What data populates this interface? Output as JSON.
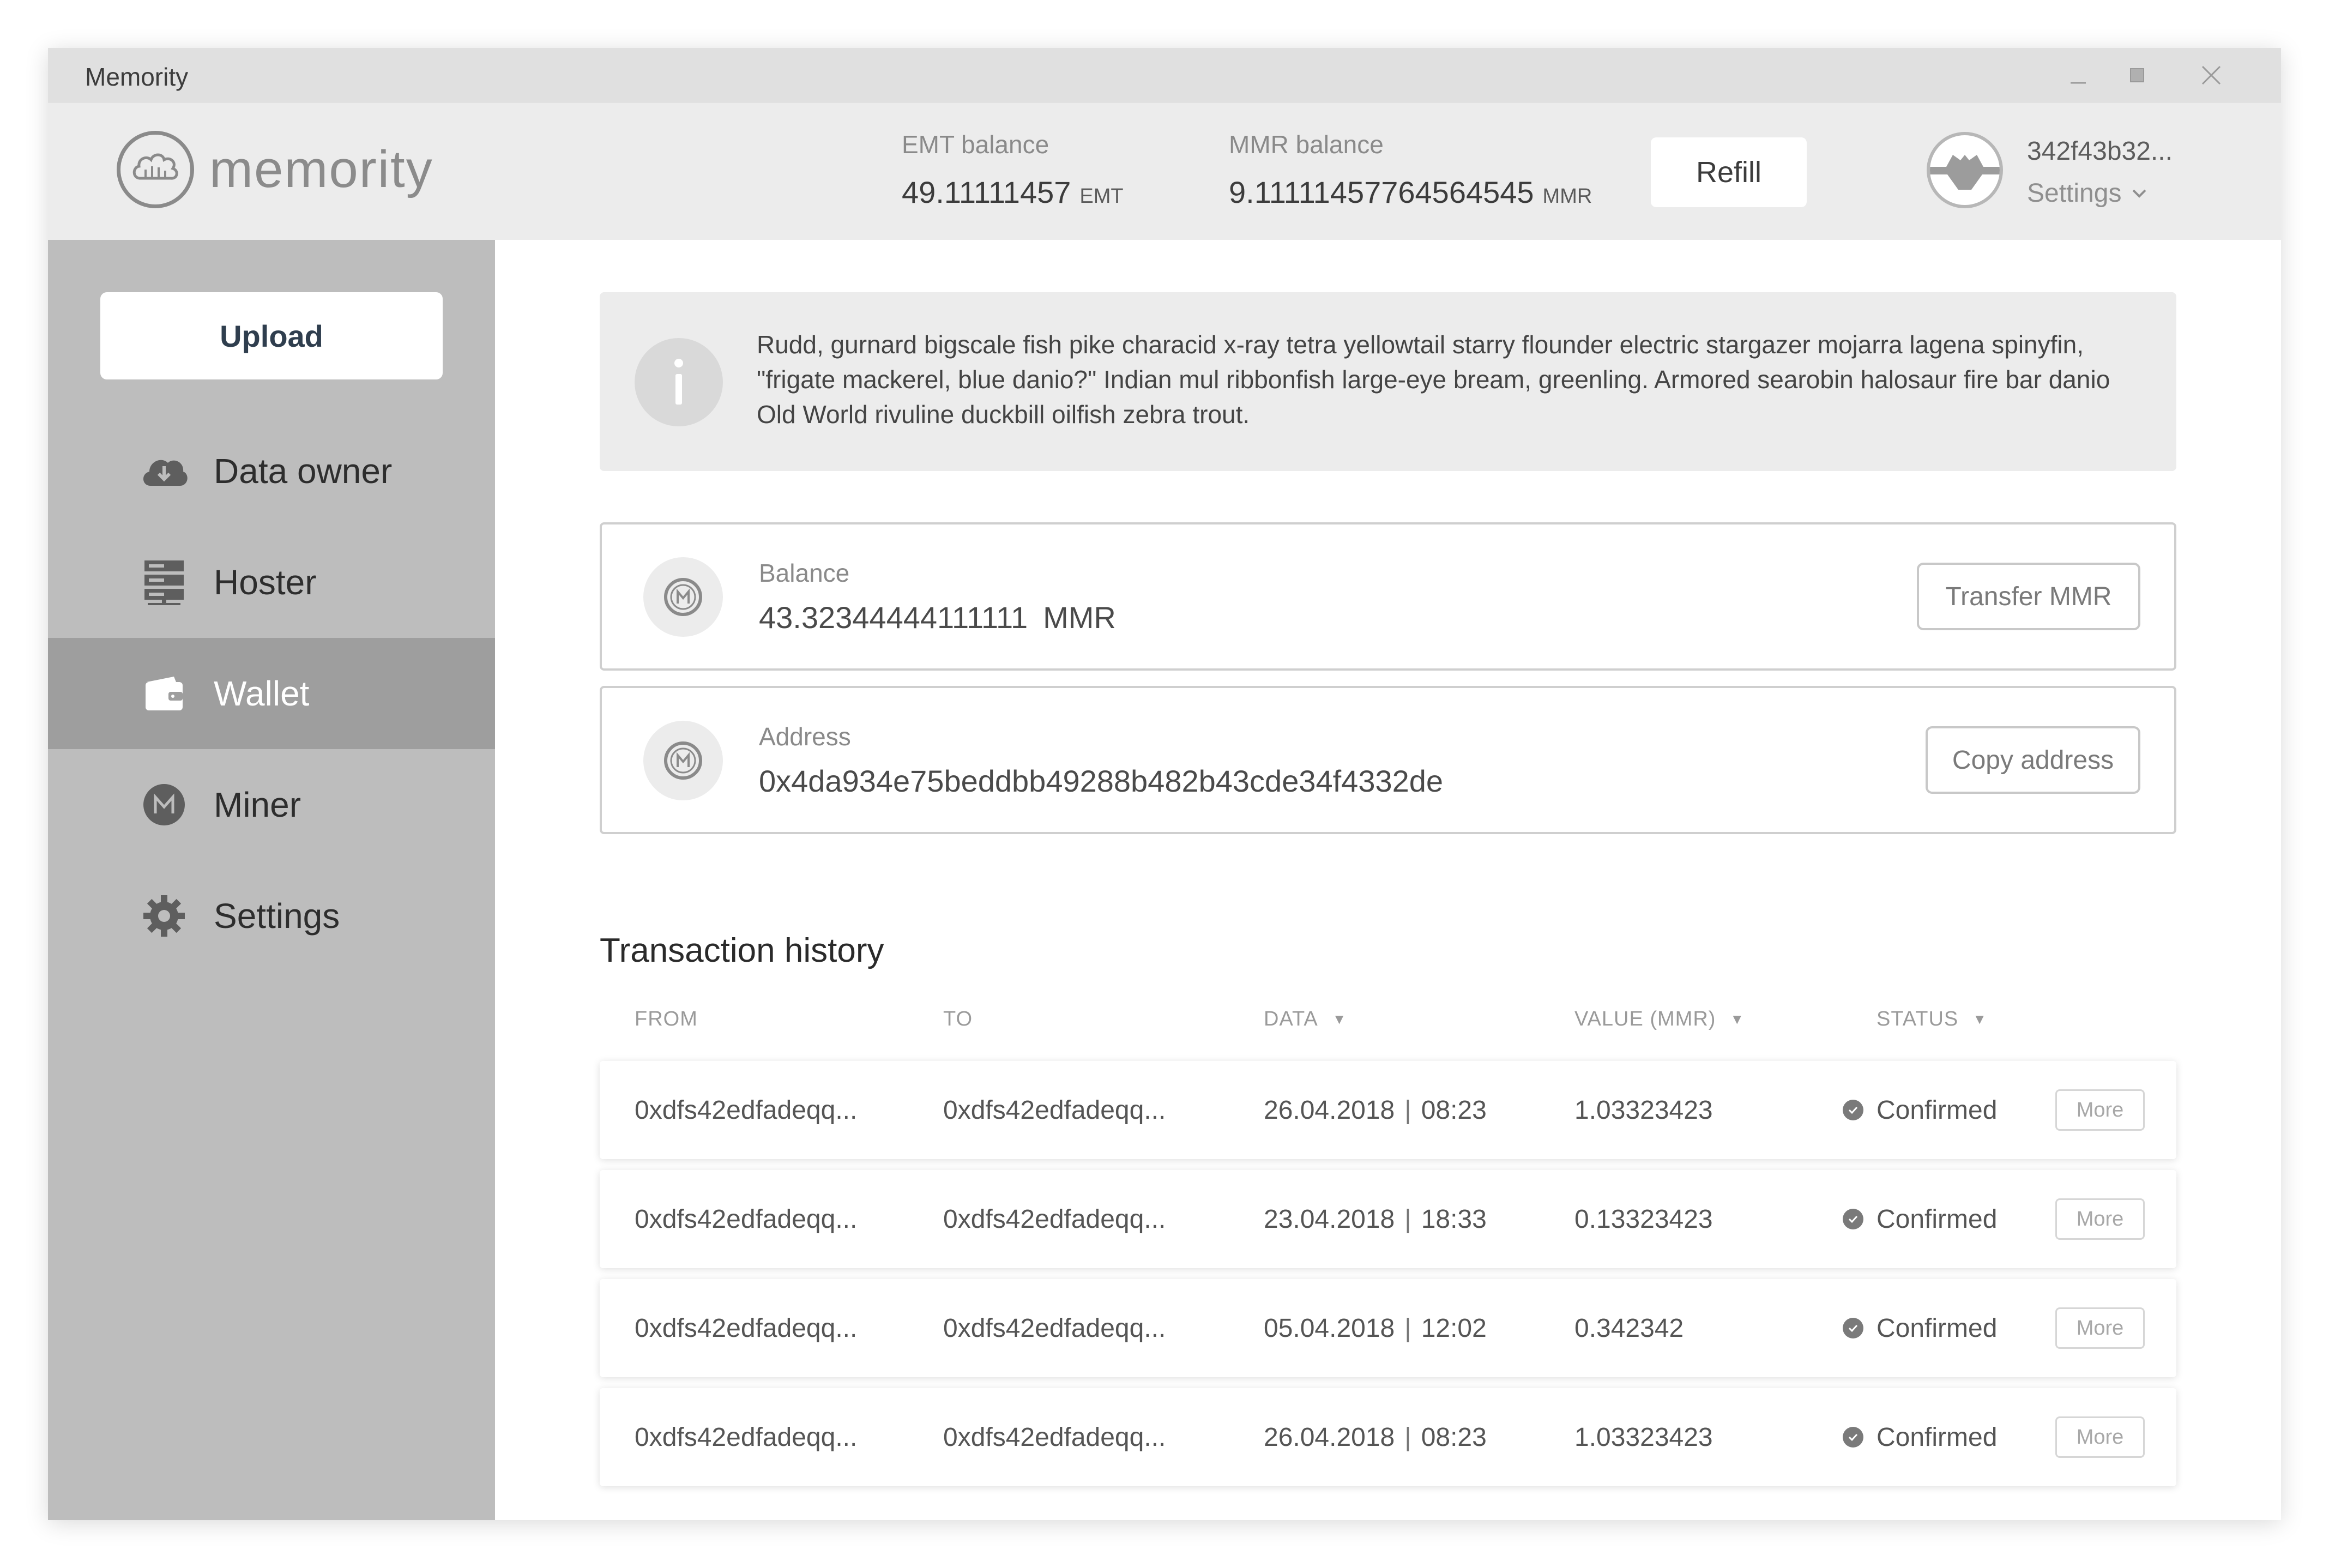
{
  "window": {
    "title": "Memority"
  },
  "header": {
    "logo_text": "memority",
    "emt": {
      "label": "EMT balance",
      "value": "49.11111457",
      "unit": "EMT"
    },
    "mmr": {
      "label": "MMR balance",
      "value": "9.11111457764564545",
      "unit": "MMR"
    },
    "refill_label": "Refill",
    "account": {
      "address": "342f43b32...",
      "settings_label": "Settings"
    }
  },
  "sidebar": {
    "upload_label": "Upload",
    "items": [
      {
        "label": "Data owner",
        "icon": "cloud-download-icon",
        "active": false
      },
      {
        "label": "Hoster",
        "icon": "server-icon",
        "active": false
      },
      {
        "label": "Wallet",
        "icon": "wallet-icon",
        "active": true
      },
      {
        "label": "Miner",
        "icon": "m-coin-icon",
        "active": false
      },
      {
        "label": "Settings",
        "icon": "gear-icon",
        "active": false
      }
    ]
  },
  "main": {
    "info_text": "Rudd, gurnard bigscale fish pike characid x-ray tetra yellowtail starry flounder electric stargazer mojarra lagena spinyfin, \"frigate mackerel, blue danio?\" Indian mul ribbonfish large-eye bream, greenling. Armored searobin halosaur fire bar danio Old World rivuline duckbill oilfish zebra trout.",
    "balance": {
      "label": "Balance",
      "value": "43.32344444111111",
      "unit": "MMR",
      "button": "Transfer MMR"
    },
    "address": {
      "label": "Address",
      "value": "0x4da934e75beddbb49288b482b43cde34f4332de",
      "button": "Copy address"
    },
    "history": {
      "title": "Transaction history",
      "columns": {
        "from": "FROM",
        "to": "TO",
        "data": "DATA",
        "value": "VALUE (MMR)",
        "status": "STATUS"
      },
      "rows": [
        {
          "from": "0xdfs42edfadeqq...",
          "to": "0xdfs42edfadeqq...",
          "date": "26.04.2018",
          "time": "08:23",
          "value": "1.03323423",
          "status": "Confirmed",
          "more": "More"
        },
        {
          "from": "0xdfs42edfadeqq...",
          "to": "0xdfs42edfadeqq...",
          "date": "23.04.2018",
          "time": "18:33",
          "value": "0.13323423",
          "status": "Confirmed",
          "more": "More"
        },
        {
          "from": "0xdfs42edfadeqq...",
          "to": "0xdfs42edfadeqq...",
          "date": "05.04.2018",
          "time": "12:02",
          "value": "0.342342",
          "status": "Confirmed",
          "more": "More"
        },
        {
          "from": "0xdfs42edfadeqq...",
          "to": "0xdfs42edfadeqq...",
          "date": "26.04.2018",
          "time": "08:23",
          "value": "1.03323423",
          "status": "Confirmed",
          "more": "More"
        }
      ]
    }
  }
}
